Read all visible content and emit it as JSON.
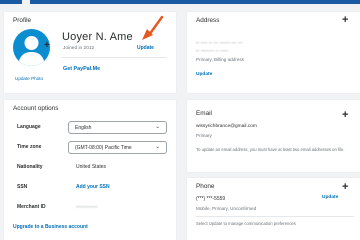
{
  "colors": {
    "accent": "#0070ba",
    "topbar": "#1a5aa4",
    "avatar": "#0b8dcf",
    "annotation": "#e8571f"
  },
  "profile": {
    "title": "Profile",
    "name": "Uoyer N. Ame",
    "joined": "Joined in 2012",
    "update_photo": "Update Photo",
    "update": "Update",
    "get_paypal_me": "Get PayPal.Me",
    "avatar_icon": "user-avatar-icon"
  },
  "address": {
    "title": "Address",
    "line1": "-- ---- -- --- ------ --- ---",
    "line2": "-- -------- -- -----",
    "primary": "Primary, Billing address",
    "update": "Update"
  },
  "account_options": {
    "title": "Account options",
    "rows": [
      {
        "label": "Language",
        "value": "English"
      },
      {
        "label": "Time zone",
        "value": "(GMT-08:00) Pacific Time"
      },
      {
        "label": "Nationality",
        "value": "United States"
      },
      {
        "label": "SSN",
        "value": "Add your SSN"
      },
      {
        "label": "Merchant ID",
        "value": "-------------"
      }
    ],
    "upgrade": "Upgrade to a Business account"
  },
  "email": {
    "title": "Email",
    "address": "wissyrichbrance@gmail.com",
    "primary": "Primary",
    "note": "To update an email address, you must have at least two email addresses on file."
  },
  "phone": {
    "title": "Phone",
    "number": "(***) ***-5559",
    "type": "Mobile, Primary, Unconfirmed",
    "update": "Update",
    "note": "Select Update to manage communication preferences"
  }
}
